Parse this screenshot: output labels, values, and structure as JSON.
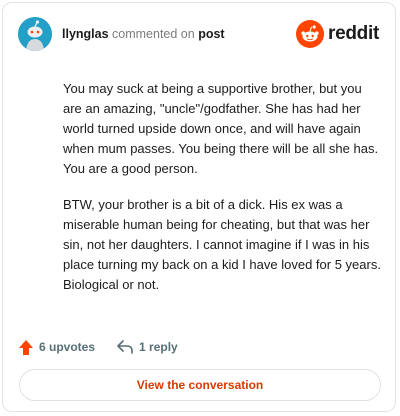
{
  "header": {
    "username": "llynglas",
    "action_text": "commented on",
    "post_link": "post",
    "brand_name": "reddit"
  },
  "comment": {
    "paragraphs": [
      "You may suck at being a supportive brother, but you are an amazing, \"uncle\"/godfather. She has had her world turned upside down once, and will have again when mum passes. You being there will be all she has. You are a good person.",
      "BTW, your brother is a bit of a dick. His ex was a miserable human being for cheating, but that was her sin, not her daughters. I cannot imagine if I was in his place turning my back on a kid I have loved for 5 years. Biological or not."
    ]
  },
  "footer": {
    "upvotes": "6 upvotes",
    "replies": "1 reply",
    "cta_label": "View the conversation"
  },
  "colors": {
    "brand_orange": "#ff4500",
    "upvote_orange": "#ff4500",
    "cta_text": "#d93a00",
    "avatar_bg": "#24a0c8"
  },
  "icons": {
    "avatar": "snoo-avatar-icon",
    "brand": "reddit-logo-icon",
    "upvote": "upvote-arrow-icon",
    "reply": "reply-arrow-icon"
  }
}
